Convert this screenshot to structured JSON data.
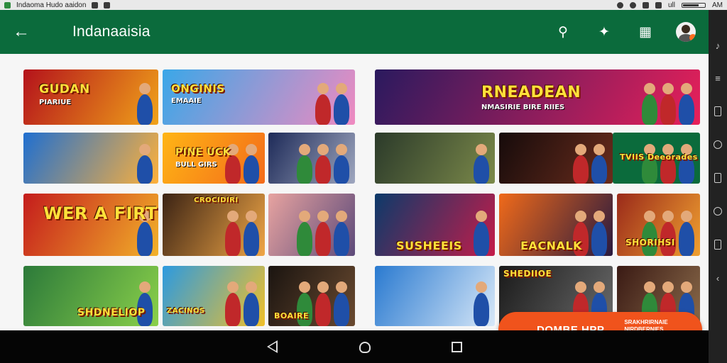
{
  "statusbar": {
    "app_name": "Indaoma Hudo aaidon",
    "signal_text": "ull",
    "corner_text": "AM"
  },
  "appbar": {
    "back_label": "←",
    "title": "Indanaaisia",
    "search_glyph": "⚲",
    "share_glyph": "✦",
    "qr_glyph": "▦"
  },
  "tiles": [
    {
      "caption": "GUDAN",
      "subtitle": "PIARIUE",
      "colors": [
        "#b4121b",
        "#f0a31a"
      ]
    },
    {
      "caption": "ONGINIS",
      "subtitle": "EMAAIE",
      "colors": [
        "#3aa7e8",
        "#f08ac0"
      ]
    },
    {
      "caption": "RNEADEAN",
      "subtitle": "NMASIRIE BIRE RIIES",
      "colors": [
        "#2a1a5e",
        "#e8205a"
      ]
    },
    {
      "caption": "",
      "subtitle": "",
      "colors": [
        "#1f6fd0",
        "#ffb13a"
      ]
    },
    {
      "caption": "PINE UCK",
      "subtitle": "BULL GIRS",
      "colors": [
        "#ffb515",
        "#f36b1a"
      ]
    },
    {
      "caption": "",
      "subtitle": "",
      "colors": [
        "#1d2a58",
        "#9fa7bf"
      ]
    },
    {
      "caption": "",
      "subtitle": "",
      "colors": [
        "#2b3a2a",
        "#7c8a4a"
      ]
    },
    {
      "caption": "",
      "subtitle": "",
      "colors": [
        "#160b0b",
        "#6a2c1c"
      ]
    },
    {
      "caption": "TVIIS Deeorades",
      "subtitle": "",
      "colors": [
        "#0b6b3c",
        "#0b6b3c"
      ]
    },
    {
      "caption": "WER A FIRTIIA",
      "subtitle": "",
      "colors": [
        "#c41c1c",
        "#f2b22a"
      ]
    },
    {
      "caption": "CROCIDIRI",
      "subtitle": "",
      "colors": [
        "#3b2314",
        "#f0a646"
      ]
    },
    {
      "caption": "",
      "subtitle": "",
      "colors": [
        "#e7a3a0",
        "#5d4a7a"
      ]
    },
    {
      "caption": "SUSHEEIS",
      "subtitle": "",
      "colors": [
        "#0c3a6a",
        "#c41c4a"
      ]
    },
    {
      "caption": "EACNALK",
      "subtitle": "",
      "colors": [
        "#f06a1a",
        "#2a1a3e"
      ]
    },
    {
      "caption": "SHORIHSI",
      "subtitle": "",
      "colors": [
        "#9a2a1a",
        "#f0a030"
      ]
    },
    {
      "caption": "SHDNELIOP",
      "subtitle": "",
      "colors": [
        "#2c7a3a",
        "#8ad04a"
      ]
    },
    {
      "caption": "ZACINOS",
      "subtitle": "",
      "colors": [
        "#2c9ae0",
        "#f0c02a"
      ]
    },
    {
      "caption": "BOAIRE",
      "subtitle": "",
      "colors": [
        "#1a1410",
        "#6a4a30"
      ]
    },
    {
      "caption": "",
      "subtitle": "",
      "colors": [
        "#2a7ad0",
        "#d8e8f8"
      ]
    },
    {
      "caption": "SHEDIIOE",
      "subtitle": "",
      "colors": [
        "#1a1a1a",
        "#6a6a6a"
      ]
    },
    {
      "caption": "",
      "subtitle": "",
      "colors": [
        "#3a1a14",
        "#8a6a4a"
      ]
    }
  ],
  "fab": {
    "label": "DOMBE HPP",
    "small_text": "SRAKHRIRNAIE NIRDBERNIES AMESOERBES"
  }
}
